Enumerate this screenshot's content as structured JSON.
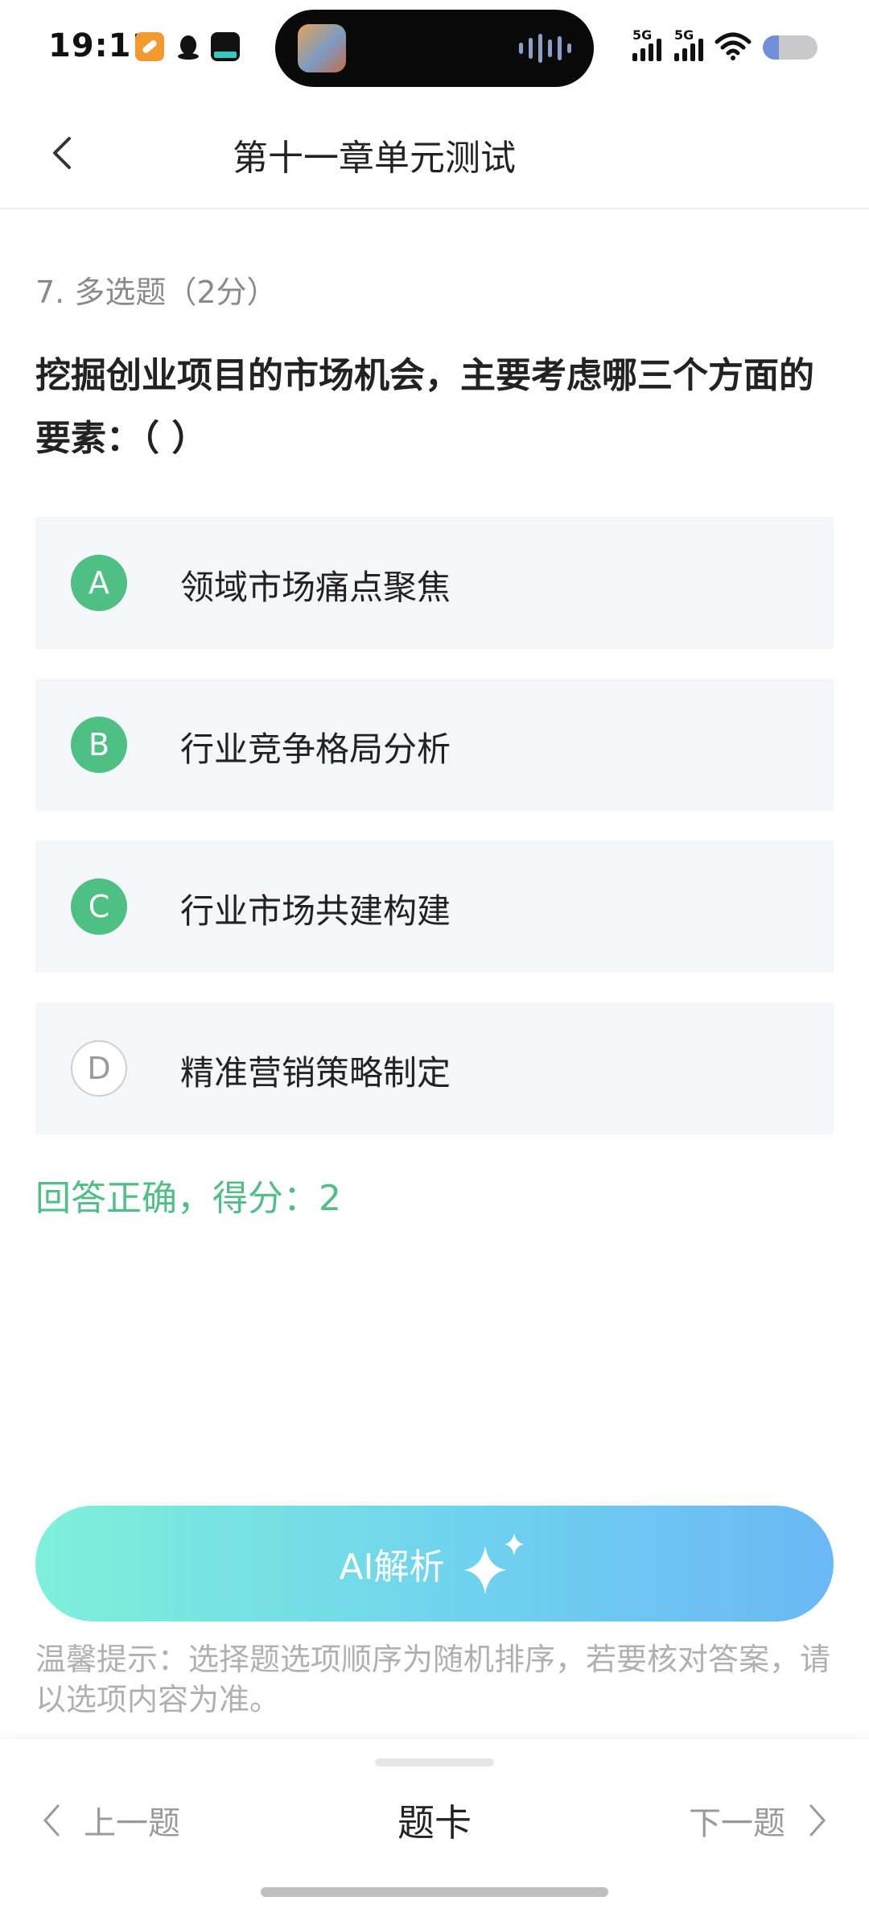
{
  "status_bar": {
    "time": "19:11",
    "signal_1_label": "5G",
    "signal_2_label": "5G",
    "battery_level": 0.3
  },
  "nav": {
    "title": "第十一章单元测试"
  },
  "question": {
    "meta": "7. 多选题（2分）",
    "text": "挖掘创业项目的市场机会，主要考虑哪三个方面的要素：（ ）"
  },
  "options": [
    {
      "letter": "A",
      "text": "领域市场痛点聚焦",
      "selected": true
    },
    {
      "letter": "B",
      "text": "行业竞争格局分析",
      "selected": true
    },
    {
      "letter": "C",
      "text": "行业市场共建构建",
      "selected": true
    },
    {
      "letter": "D",
      "text": "精准营销策略制定",
      "selected": false
    }
  ],
  "result": "回答正确，得分：2",
  "ai_button": {
    "label": "AI解析",
    "icon": "sparkle-icon"
  },
  "tip": "温馨提示：选择题选项顺序为随机排序，若要核对答案，请以选项内容为准。",
  "bottom_bar": {
    "prev_label": "上一题",
    "card_label": "题卡",
    "next_label": "下一题"
  },
  "colors": {
    "accent_green": "#4fc083",
    "ai_gradient_start": "#7ef0d9",
    "ai_gradient_end": "#6ab8f5"
  }
}
